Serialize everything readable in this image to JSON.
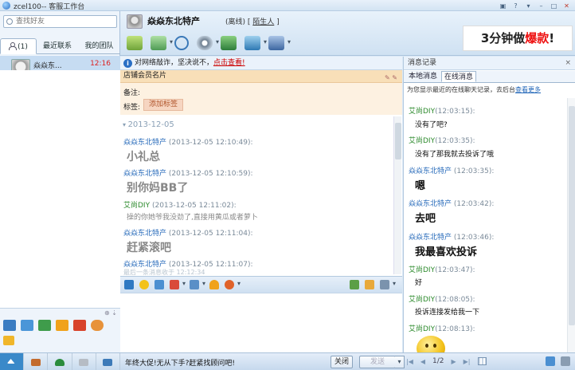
{
  "window": {
    "title": "zcel100-- 客服工作台"
  },
  "sidebar": {
    "search_placeholder": "查找好友",
    "tabs": [
      {
        "label": "(1)"
      },
      {
        "label": "最近联系"
      },
      {
        "label": "我的团队"
      }
    ],
    "contacts": [
      {
        "name": "焱焱东...",
        "time": "12:16"
      }
    ]
  },
  "header": {
    "contact_name": "焱焱东北特产",
    "contact_status": "(离线)",
    "group_bracket_open": "[",
    "group": "陌生人",
    "group_bracket_close": "]",
    "ad_text_a": "3分钟做",
    "ad_text_hot": "爆款",
    "ad_text_b": "!"
  },
  "notice": {
    "text": "对网络敲诈，坚决说不，",
    "link": "点击查看!"
  },
  "member_card": {
    "title": "店铺会员名片",
    "note_label": "备注:",
    "tag_label": "标签:",
    "tag_button": "添加标签"
  },
  "chat": {
    "date": "2013-12-05",
    "messages": [
      {
        "who": "焱焱东北特产",
        "time": "(2013-12-05 12:10:49):",
        "text": "小礼总",
        "me": false
      },
      {
        "who": "焱焱东北特产",
        "time": "(2013-12-05 12:10:59):",
        "text": "别你妈BB了",
        "me": false
      },
      {
        "who": "艾尚DIY",
        "time": "(2013-12-05 12:11:02):",
        "text": "操的你她爷我没劲了,直接用黄瓜或者萝卜",
        "me": true
      },
      {
        "who": "焱焱东北特产",
        "time": "(2013-12-05 12:11:04):",
        "text": "赶紧滚吧",
        "me": false
      },
      {
        "who": "焱焱东北特产",
        "time": "(2013-12-05 12:11:07):",
        "text": "",
        "me": false
      }
    ],
    "last_msg_note": "最后一条消息收于 12:12:34"
  },
  "footer": {
    "promo": "年终大促!无从下手?赶紧找顾问吧!",
    "close_button": "关闭",
    "send_button": "发送",
    "page_indicator": "1/2"
  },
  "history": {
    "title": "消息记录",
    "close": "×",
    "tabs": [
      {
        "label": "本地消息"
      },
      {
        "label": "在线消息"
      }
    ],
    "desc": "为您显示最近的在线聊天记录，去后台",
    "desc_link": "查看更多",
    "messages": [
      {
        "who": "艾尚DIY",
        "time": "(12:03:15):",
        "text": "没有了吧?",
        "big": false
      },
      {
        "who": "艾尚DIY",
        "time": "(12:03:35):",
        "text": "没有了那我就去投诉了哦",
        "big": false
      },
      {
        "who": "焱焱东北特产",
        "time": "(12:03:35):",
        "text": "嗯",
        "big": true
      },
      {
        "who": "焱焱东北特产",
        "time": "(12:03:42):",
        "text": "去吧",
        "big": true
      },
      {
        "who": "焱焱东北特产",
        "time": "(12:03:46):",
        "text": "我最喜欢投诉",
        "big": true
      },
      {
        "who": "艾尚DIY",
        "time": "(12:03:47):",
        "text": "好",
        "big": false
      },
      {
        "who": "艾尚DIY",
        "time": "(12:08:05):",
        "text": "投诉连接发给我一下",
        "big": false
      },
      {
        "who": "艾尚DIY",
        "time": "(12:08:13):",
        "text": "",
        "big": false
      }
    ]
  },
  "colors": {
    "accent": "#2166b8",
    "own_name": "#2c8a2c",
    "alert": "#e11111",
    "card_header": "#f8dfb8"
  }
}
